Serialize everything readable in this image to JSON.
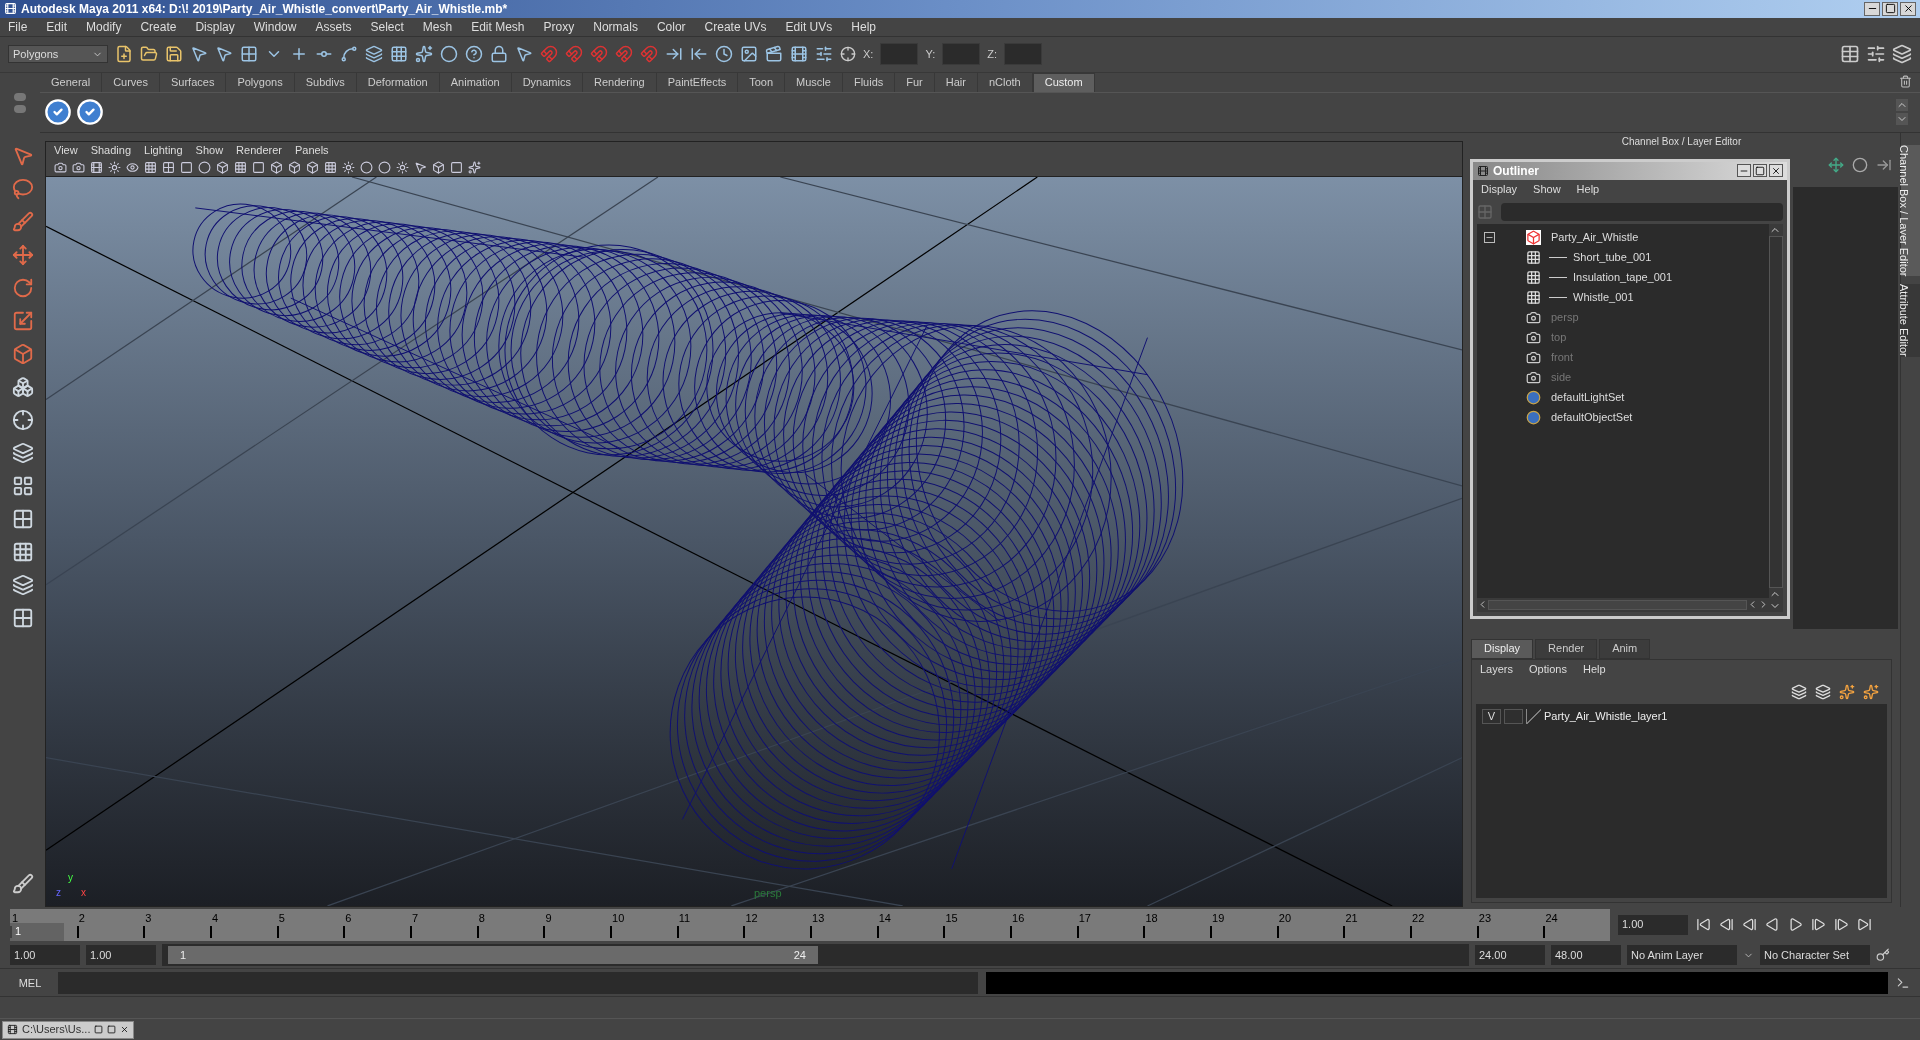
{
  "window": {
    "title": "Autodesk Maya 2011 x64: D:\\! 2019\\Party_Air_Whistle_convert\\Party_Air_Whistle.mb*"
  },
  "menu_bar": [
    "File",
    "Edit",
    "Modify",
    "Create",
    "Display",
    "Window",
    "Assets",
    "Select",
    "Mesh",
    "Edit Mesh",
    "Proxy",
    "Normals",
    "Color",
    "Create UVs",
    "Edit UVs",
    "Help"
  ],
  "status_line": {
    "menu_set": "Polygons",
    "coord_labels": [
      "X:",
      "Y:",
      "Z:"
    ]
  },
  "shelf": {
    "tabs": [
      {
        "label": "General",
        "selected": false
      },
      {
        "label": "Curves",
        "selected": false
      },
      {
        "label": "Surfaces",
        "selected": false
      },
      {
        "label": "Polygons",
        "selected": false
      },
      {
        "label": "Subdivs",
        "selected": false
      },
      {
        "label": "Deformation",
        "selected": false
      },
      {
        "label": "Animation",
        "selected": false
      },
      {
        "label": "Dynamics",
        "selected": false
      },
      {
        "label": "Rendering",
        "selected": false
      },
      {
        "label": "PaintEffects",
        "selected": false
      },
      {
        "label": "Toon",
        "selected": false
      },
      {
        "label": "Muscle",
        "selected": false
      },
      {
        "label": "Fluids",
        "selected": false
      },
      {
        "label": "Fur",
        "selected": false
      },
      {
        "label": "Hair",
        "selected": false
      },
      {
        "label": "nCloth",
        "selected": false
      },
      {
        "label": "Custom",
        "selected": true
      }
    ]
  },
  "viewport": {
    "menu": [
      "View",
      "Shading",
      "Lighting",
      "Show",
      "Renderer",
      "Panels"
    ],
    "camera_label": "persp",
    "axis_labels": [
      "y",
      "z",
      "x"
    ]
  },
  "channel_box": {
    "title": "Channel Box / Layer Editor"
  },
  "outliner": {
    "title": "Outliner",
    "menu": [
      "Display",
      "Show",
      "Help"
    ],
    "items": [
      {
        "label": "Party_Air_Whistle",
        "kind": "group",
        "dimmed": false,
        "expanded": true,
        "children": [
          {
            "label": "Short_tube_001",
            "kind": "mesh",
            "dimmed": false
          },
          {
            "label": "Insulation_tape_001",
            "kind": "mesh",
            "dimmed": false
          },
          {
            "label": "Whistle_001",
            "kind": "mesh",
            "dimmed": false
          }
        ]
      },
      {
        "label": "persp",
        "kind": "camera",
        "dimmed": true
      },
      {
        "label": "top",
        "kind": "camera",
        "dimmed": true
      },
      {
        "label": "front",
        "kind": "camera",
        "dimmed": true
      },
      {
        "label": "side",
        "kind": "camera",
        "dimmed": true
      },
      {
        "label": "defaultLightSet",
        "kind": "set",
        "dimmed": false
      },
      {
        "label": "defaultObjectSet",
        "kind": "set",
        "dimmed": false
      }
    ]
  },
  "layer_editor": {
    "tabs": [
      {
        "label": "Display",
        "selected": true
      },
      {
        "label": "Render",
        "selected": false
      },
      {
        "label": "Anim",
        "selected": false
      }
    ],
    "menu": [
      "Layers",
      "Options",
      "Help"
    ],
    "layers": [
      {
        "visibility": "V",
        "name": "Party_Air_Whistle_layer1"
      }
    ]
  },
  "side_tabs": [
    "Channel Box / Layer Editor",
    "Attribute Editor"
  ],
  "time_slider": {
    "ticks": [
      "1",
      "2",
      "3",
      "4",
      "5",
      "6",
      "7",
      "8",
      "9",
      "10",
      "11",
      "12",
      "13",
      "14",
      "15",
      "16",
      "17",
      "18",
      "19",
      "20",
      "21",
      "22",
      "23",
      "24"
    ],
    "current_frame": "1",
    "current_time": "1.00"
  },
  "range_slider": {
    "start_time": "1.00",
    "playback_start": "1.00",
    "range_start": "1",
    "range_end": "24",
    "playback_end": "24.00",
    "end_time": "48.00",
    "anim_layer": "No Anim Layer",
    "character_set": "No Character Set"
  },
  "command_line": {
    "label": "MEL"
  },
  "taskbar": {
    "title": "C:\\Users\\Us..."
  }
}
